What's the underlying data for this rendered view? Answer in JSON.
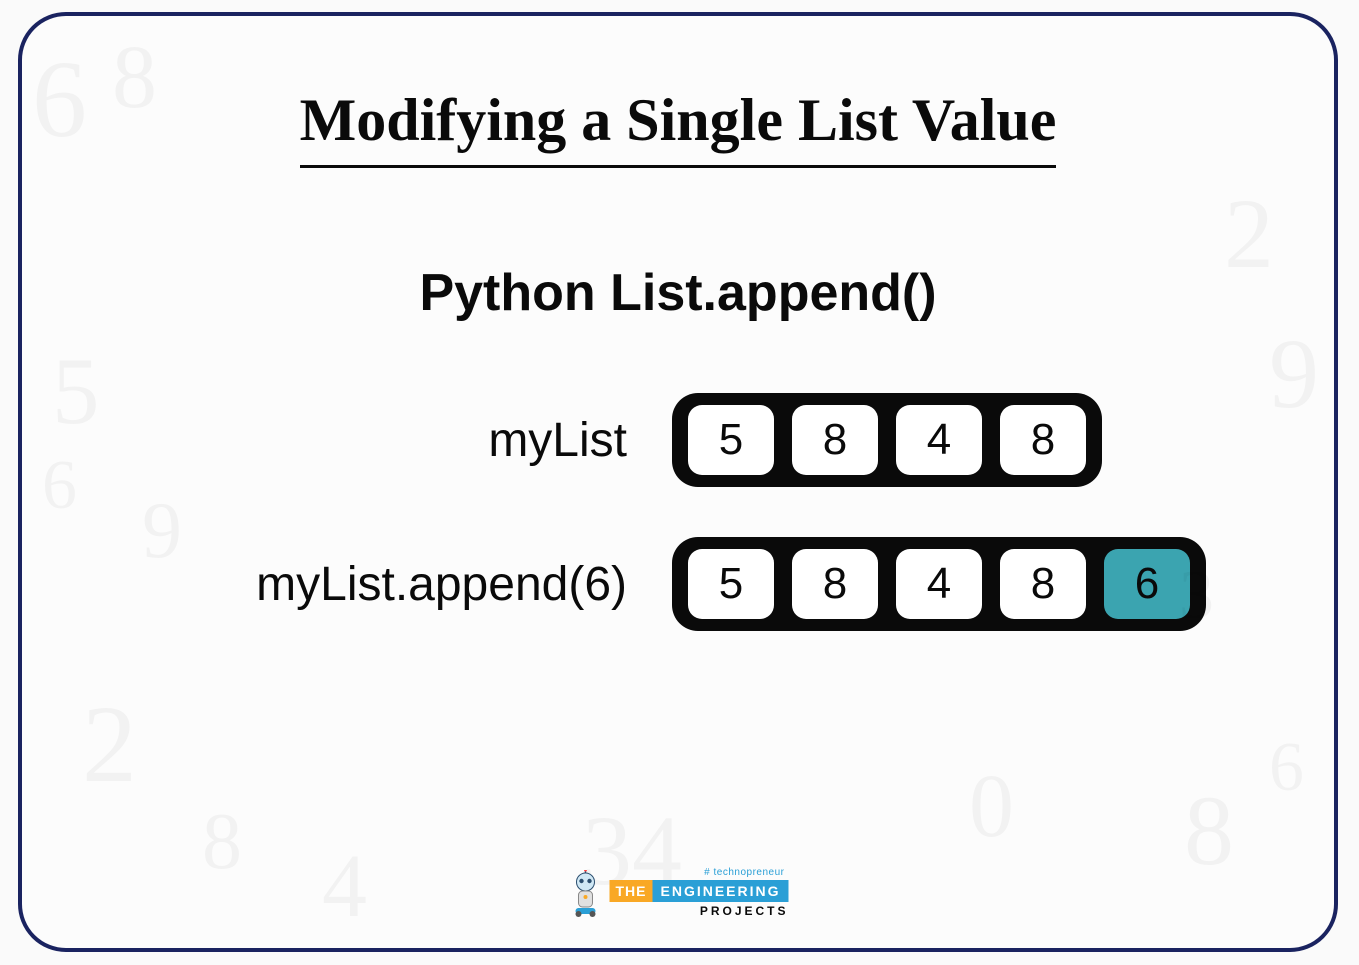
{
  "title": "Modifying a Single List Value",
  "subtitle": "Python List.append()",
  "rows": [
    {
      "label": "myList",
      "cells": [
        {
          "value": "5",
          "highlight": false
        },
        {
          "value": "8",
          "highlight": false
        },
        {
          "value": "4",
          "highlight": false
        },
        {
          "value": "8",
          "highlight": false
        }
      ]
    },
    {
      "label": "myList.append(6)",
      "cells": [
        {
          "value": "5",
          "highlight": false
        },
        {
          "value": "8",
          "highlight": false
        },
        {
          "value": "4",
          "highlight": false
        },
        {
          "value": "8",
          "highlight": false
        },
        {
          "value": "6",
          "highlight": true
        }
      ]
    }
  ],
  "logo": {
    "hashtag": "# technopreneur",
    "word_the": "THE",
    "word_engineering": "ENGINEERING",
    "word_projects": "PROJECTS"
  }
}
